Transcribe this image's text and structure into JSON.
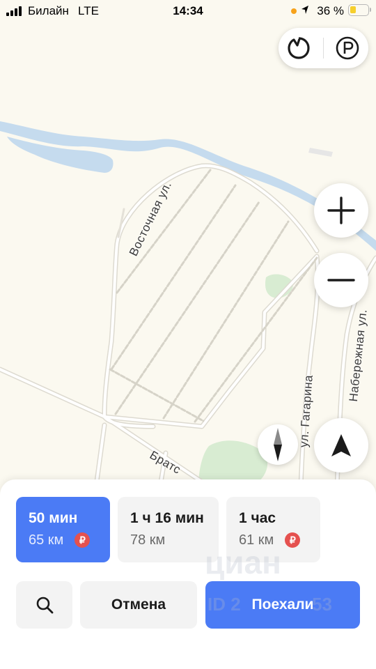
{
  "status_bar": {
    "carrier": "Билайн",
    "network": "LTE",
    "time": "14:34",
    "battery": "36 %",
    "battery_level": 0.36
  },
  "map": {
    "streets": [
      "Восточная ул.",
      "ул. Гагарина",
      "Набережная ул.",
      "Братс"
    ],
    "colors": {
      "land": "#fbf9f0",
      "water": "#c5dbee",
      "park": "#d8ecd2",
      "road": "#ffffff",
      "road_edge": "#dddad0"
    }
  },
  "controls": {
    "top_left_icon": "loop-icon",
    "top_right_icon": "parking-icon",
    "zoom_in_icon": "plus-icon",
    "zoom_out_icon": "minus-icon",
    "compass_icon": "compass-icon",
    "navigate_icon": "navigation-arrow-icon"
  },
  "routes": [
    {
      "time": "50 мин",
      "distance": "65 км",
      "toll": "₽",
      "selected": true
    },
    {
      "time": "1 ч 16 мин",
      "distance": "78 км",
      "selected": false
    },
    {
      "time": "1 час",
      "distance": "61 км",
      "toll": "₽",
      "selected": false
    }
  ],
  "actions": {
    "search_icon": "search-icon",
    "cancel": "Отмена",
    "go": "Поехали"
  },
  "watermark": {
    "brand": "циан",
    "id": "ID 2",
    "id_suffix": "53"
  },
  "accent": "#4b7bf5"
}
